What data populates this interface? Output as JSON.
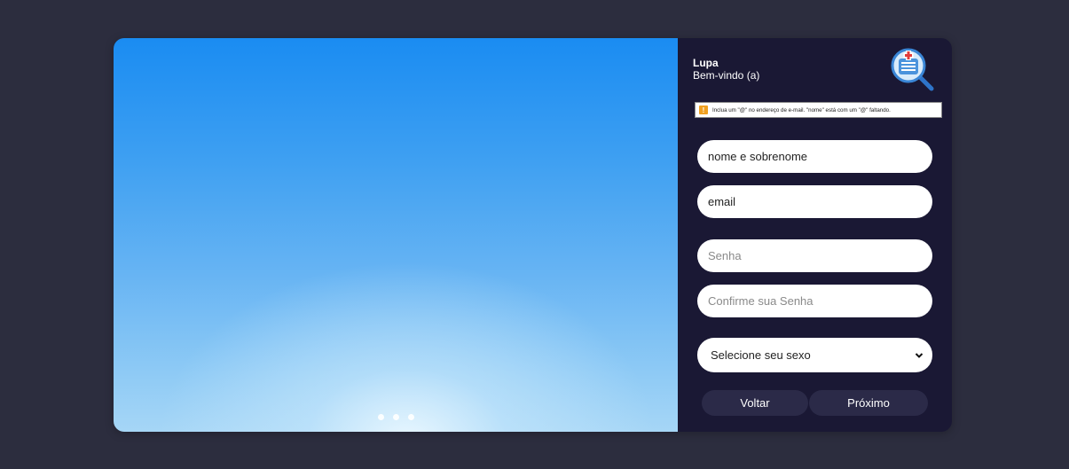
{
  "header": {
    "app_name": "Lupa",
    "welcome": "Bem-vindo (a)"
  },
  "logo": {
    "icon": "medical-magnifier-logo"
  },
  "validation": {
    "icon": "warning-icon",
    "glyph": "!",
    "message": "Inclua um \"@\" no endereço de e-mail. \"nome\" está com um \"@\" faltando."
  },
  "form": {
    "name_value": "nome e sobrenome",
    "email_value": "email",
    "password_placeholder": "Senha",
    "confirm_placeholder": "Confirme sua Senha",
    "gender_select": "Selecione seu sexo",
    "back_label": "Voltar",
    "next_label": "Próximo"
  },
  "carousel": {
    "slides": 3,
    "current": 1
  },
  "colors": {
    "page_bg": "#2c2d3e",
    "panel_bg": "#1a1834",
    "button_bg": "#2b2a48",
    "warning": "#f0a020"
  }
}
